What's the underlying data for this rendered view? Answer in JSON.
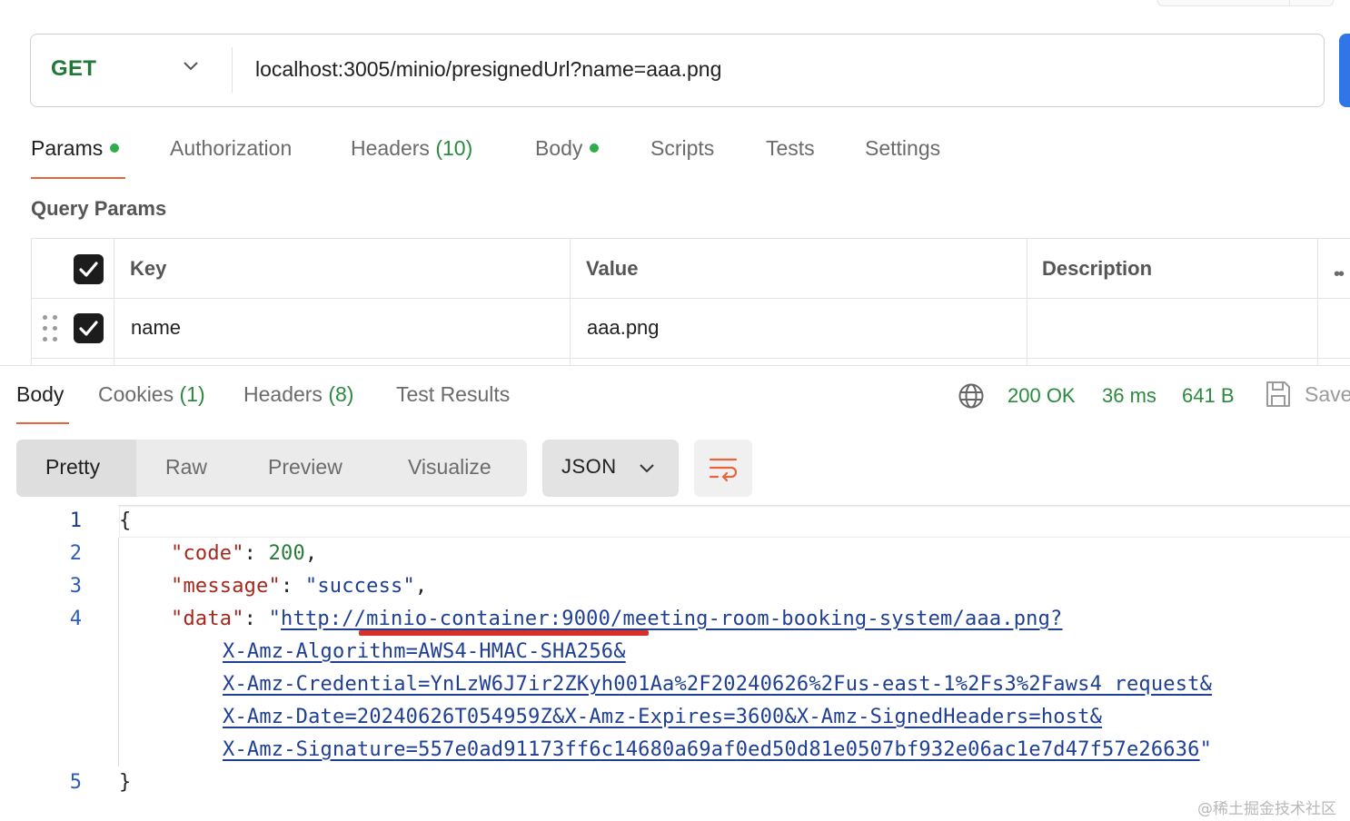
{
  "request": {
    "method": "GET",
    "url": "localhost:3005/minio/presignedUrl?name=aaa.png"
  },
  "request_tabs": {
    "params": "Params",
    "authorization": "Authorization",
    "headers": "Headers",
    "headers_count": "(10)",
    "body": "Body",
    "scripts": "Scripts",
    "tests": "Tests",
    "settings": "Settings"
  },
  "query_params": {
    "title": "Query Params",
    "columns": {
      "key": "Key",
      "value": "Value",
      "description": "Description"
    },
    "more": "••",
    "rows": [
      {
        "key": "name",
        "value": "aaa.png",
        "description": "",
        "checked": true
      }
    ]
  },
  "response_tabs": {
    "body": "Body",
    "cookies": "Cookies",
    "cookies_count": "(1)",
    "headers": "Headers",
    "headers_count": "(8)",
    "test_results": "Test Results"
  },
  "status": {
    "code": "200 OK",
    "time": "36 ms",
    "size": "641 B",
    "save": "Save"
  },
  "view": {
    "modes": [
      "Pretty",
      "Raw",
      "Preview",
      "Visualize"
    ],
    "active_mode": "Pretty",
    "format": "JSON"
  },
  "code": {
    "line_numbers": [
      "1",
      "2",
      "3",
      "4",
      "5"
    ],
    "open_brace": "{",
    "close_brace": "}",
    "code_key": "\"code\"",
    "code_value": "200",
    "message_key": "\"message\"",
    "message_value": "\"success\"",
    "data_key": "\"data\"",
    "data_lines": [
      "http://minio-container:9000/meeting-room-booking-system/aaa.png?",
      "X-Amz-Algorithm=AWS4-HMAC-SHA256&",
      "X-Amz-Credential=YnLzW6J7ir2ZKyh001Aa%2F20240626%2Fus-east-1%2Fs3%2Faws4_request&",
      "X-Amz-Date=20240626T054959Z&X-Amz-Expires=3600&X-Amz-SignedHeaders=host&",
      "X-Amz-Signature=557e0ad91173ff6c14680a69af0ed50d81e0507bf932e06ac1e7d47f57e26636"
    ]
  },
  "watermark": "@稀土掘金技术社区",
  "colors": {
    "accent": "#e8643c",
    "success": "#2b8a3e",
    "send": "#2f76e8",
    "annotation": "#d9312a"
  }
}
